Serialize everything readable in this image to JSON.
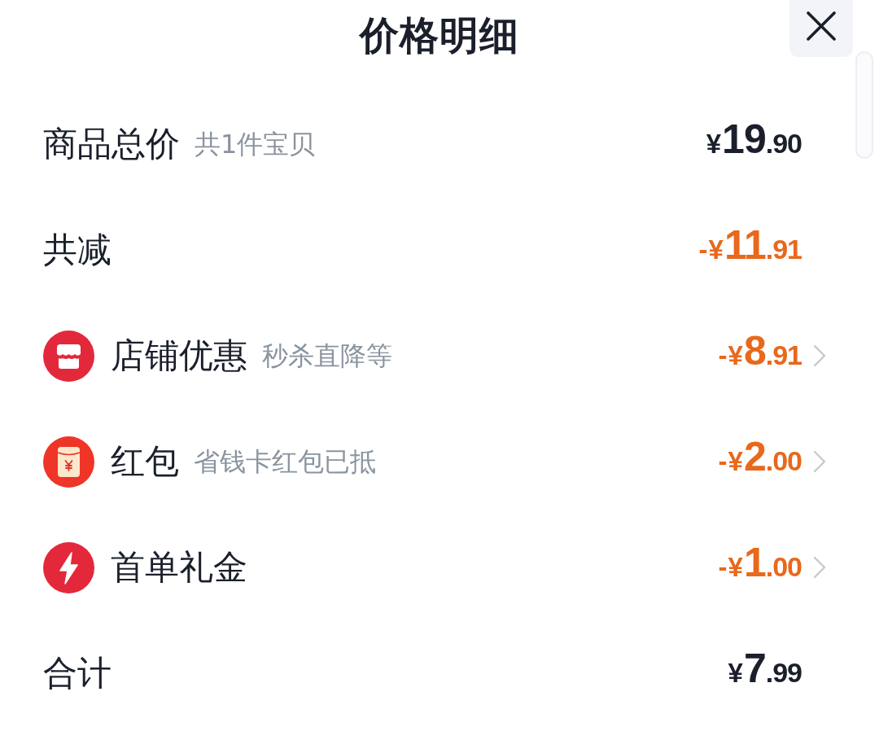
{
  "header": {
    "title": "价格明细"
  },
  "rows": [
    {
      "kind": "sum",
      "label": "商品总价",
      "note": "共1件宝贝",
      "amount": "¥19.90"
    },
    {
      "kind": "reduction",
      "label": "共减",
      "amount": "-¥11.91"
    },
    {
      "kind": "shop",
      "label": "店铺优惠",
      "note": "秒杀直降等",
      "amount": "-¥8.91"
    },
    {
      "kind": "redpacket",
      "label": "红包",
      "note": "省钱卡红包已抵",
      "amount": "-¥2.00"
    },
    {
      "kind": "flash",
      "label": "首单礼金",
      "amount": "-¥1.00"
    },
    {
      "kind": "sum",
      "label": "合计",
      "amount": "¥7.99"
    }
  ]
}
